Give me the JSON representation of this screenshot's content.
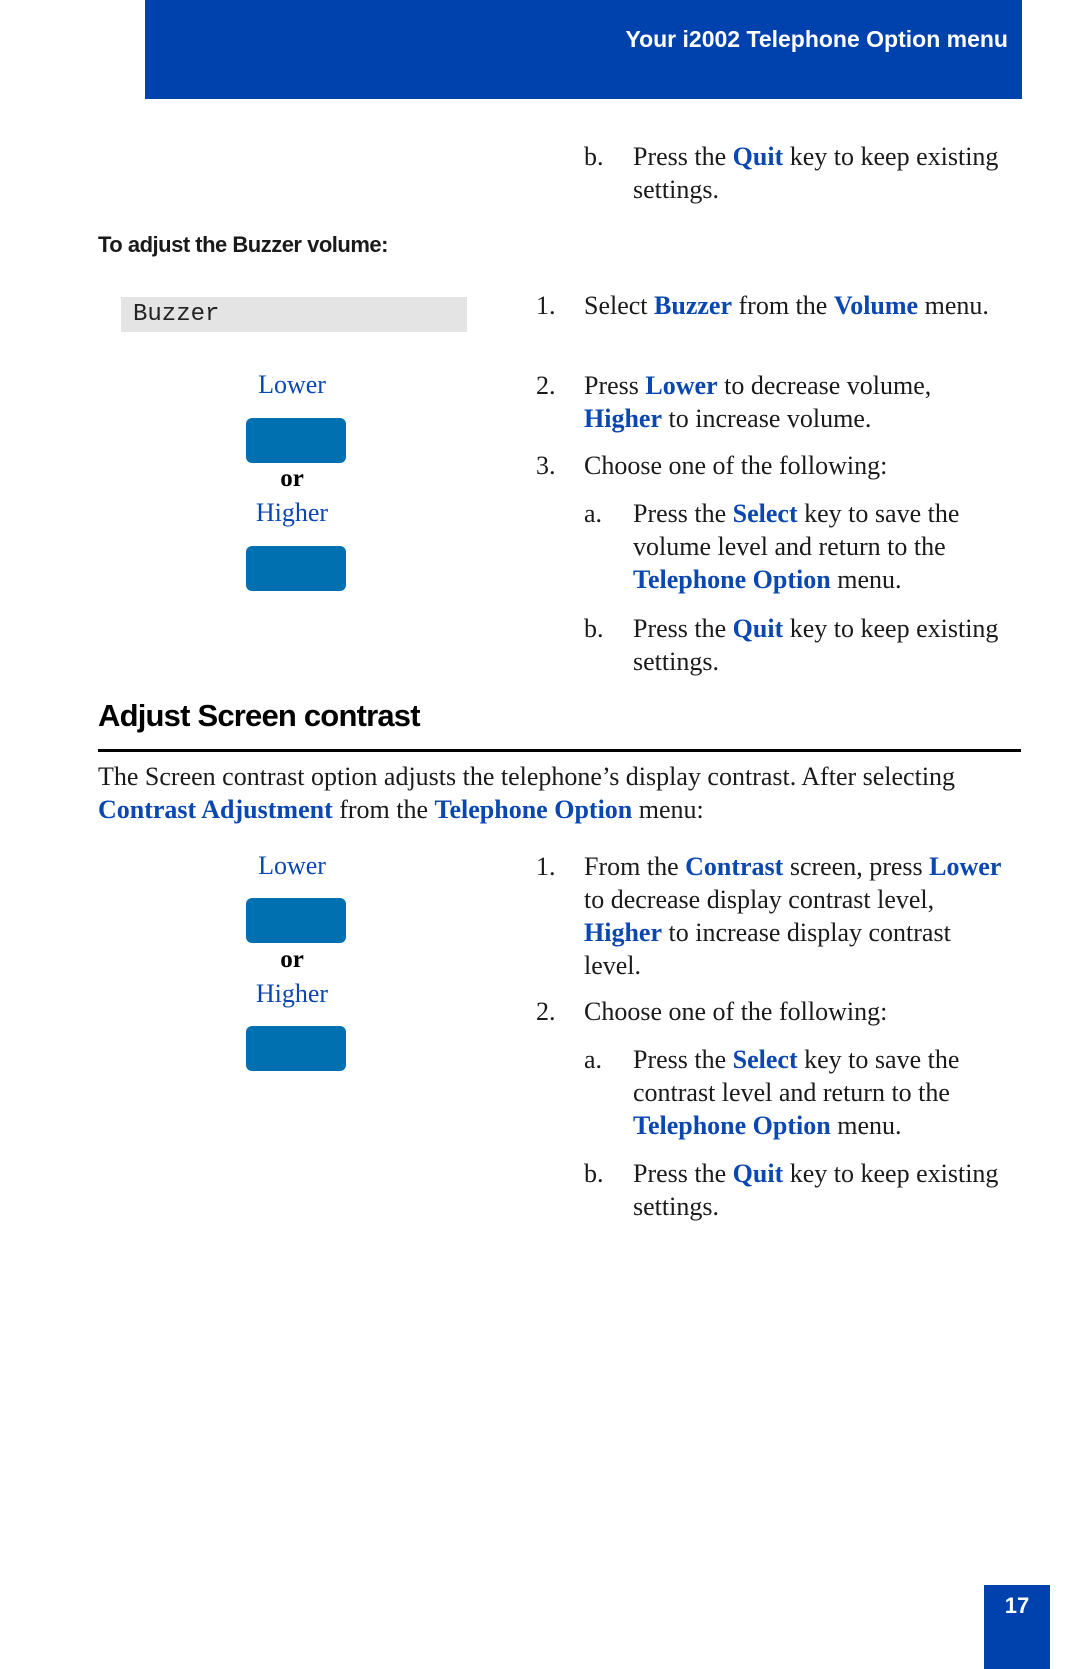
{
  "header": {
    "title": "Your i2002 Telephone Option menu",
    "color": "#0042ad"
  },
  "top_continuation": {
    "marker": "b.",
    "pre": "Press the ",
    "kw": "Quit",
    "post": " key to keep existing",
    "line2": "settings."
  },
  "buzzer": {
    "subheading": "To adjust the Buzzer volume:",
    "display_text": "Buzzer",
    "softkeys": {
      "lower_label": "Lower",
      "or_label": "or",
      "higher_label": "Higher"
    },
    "steps": {
      "s1": {
        "num": "1.",
        "a": "Select ",
        "k1": "Buzzer",
        "b": " from the ",
        "k2": "Volume",
        "c": " menu."
      },
      "s2": {
        "num": "2.",
        "a": "Press ",
        "k1": "Lower",
        "b": " to decrease volume,",
        "k2": "Higher",
        "c": " to increase volume."
      },
      "s3": {
        "num": "3.",
        "text": "Choose one of the following:"
      },
      "s3a": {
        "marker": "a.",
        "a": "Press the ",
        "k1": "Select",
        "b": " key to save the",
        "line2": "volume level and return to the",
        "k2": "Telephone Option",
        "c": " menu."
      },
      "s3b": {
        "marker": "b.",
        "a": "Press the ",
        "k1": "Quit",
        "b": " key to keep existing",
        "line2": "settings."
      }
    }
  },
  "contrast": {
    "heading": "Adjust Screen contrast",
    "intro": {
      "line1": "The Screen contrast option adjusts the telephone’s display contrast. After selecting",
      "k1": "Contrast Adjustment",
      "mid": " from the ",
      "k2": "Telephone Option",
      "end": " menu:"
    },
    "softkeys": {
      "lower_label": "Lower",
      "or_label": "or",
      "higher_label": "Higher"
    },
    "steps": {
      "s1": {
        "num": "1.",
        "a": "From the ",
        "k1": "Contrast",
        "b": " screen, press ",
        "k2": "Lower",
        "line2": "to decrease display contrast level,",
        "k3": "Higher",
        "c": " to increase display contrast",
        "line4": "level."
      },
      "s2": {
        "num": "2.",
        "text": "Choose one of the following:"
      },
      "s2a": {
        "marker": "a.",
        "a": "Press the ",
        "k1": "Select",
        "b": " key to save the",
        "line2": "contrast level and return to the",
        "k2": "Telephone Option",
        "c": " menu."
      },
      "s2b": {
        "marker": "b.",
        "a": "Press the ",
        "k1": "Quit",
        "b": " key to keep existing",
        "line2": "settings."
      }
    }
  },
  "footer": {
    "page_number": "17"
  }
}
